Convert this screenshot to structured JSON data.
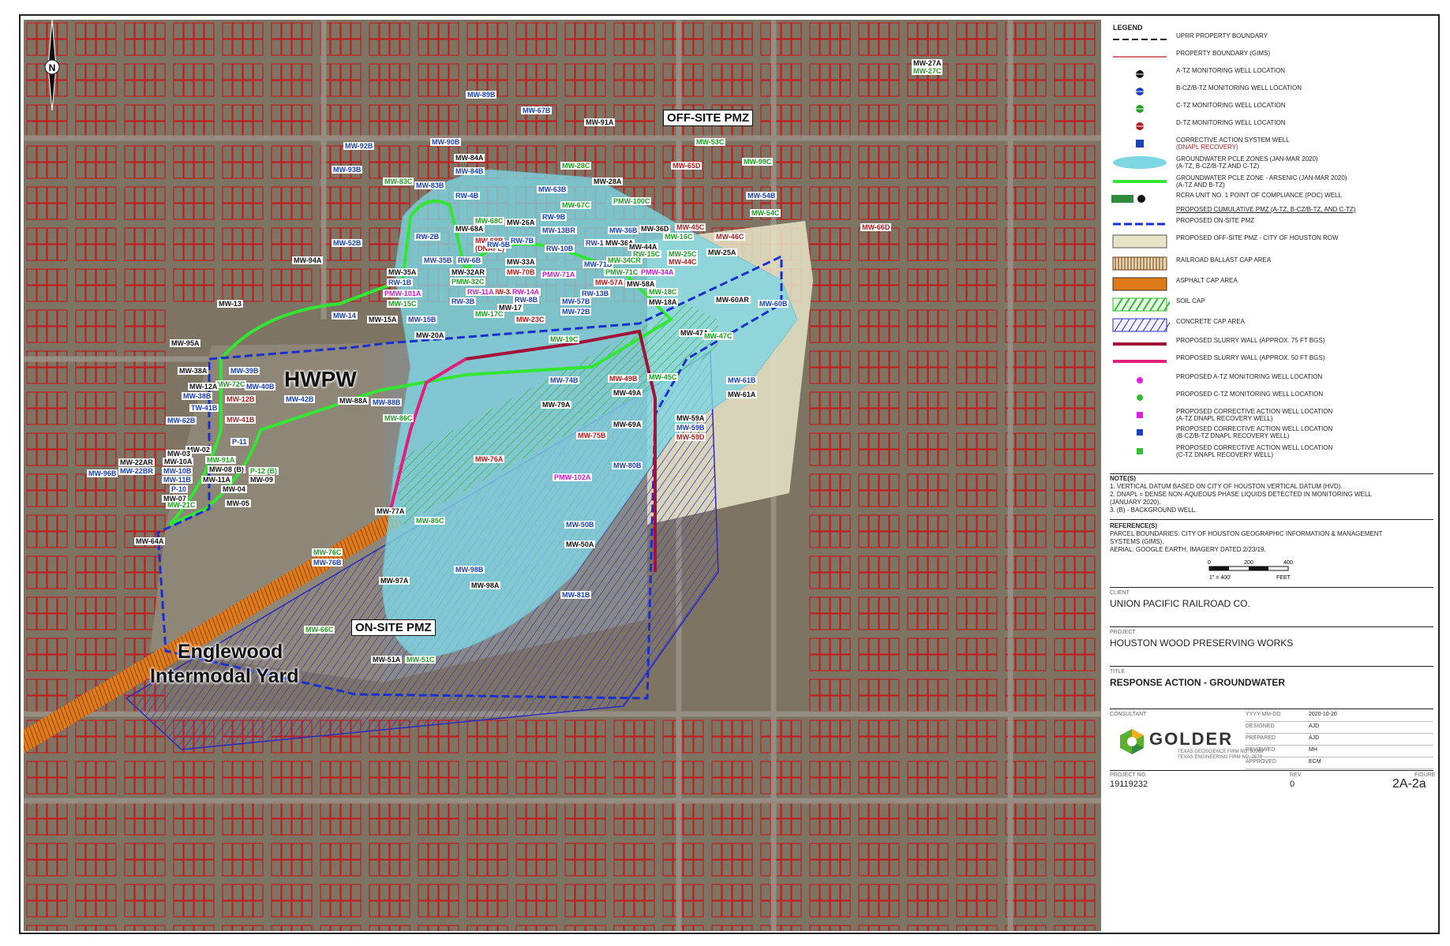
{
  "map": {
    "north_label": "N",
    "site_labels": {
      "hwpw": "HWPW",
      "englewood_line1": "Englewood",
      "englewood_line2": "Intermodal Yard"
    },
    "callouts": {
      "offsite": "OFF-SITE PMZ",
      "onsite": "ON-SITE PMZ"
    },
    "wells": [
      {
        "t": "MW-89B",
        "c": "b"
      },
      {
        "t": "MW-67B",
        "c": "b"
      },
      {
        "t": "MW-91A",
        "c": "k"
      },
      {
        "t": "MW-92B",
        "c": "b"
      },
      {
        "t": "MW-90B",
        "c": "b"
      },
      {
        "t": "MW-84A",
        "c": "k"
      },
      {
        "t": "MW-84B",
        "c": "b"
      },
      {
        "t": "MW-93B",
        "c": "b"
      },
      {
        "t": "MW-83C",
        "c": "g"
      },
      {
        "t": "MW-83B",
        "c": "b"
      },
      {
        "t": "RW-4B",
        "c": "b"
      },
      {
        "t": "MW-28C",
        "c": "g"
      },
      {
        "t": "MW-28A",
        "c": "k"
      },
      {
        "t": "MW-63B",
        "c": "b"
      },
      {
        "t": "MW-53C",
        "c": "g"
      },
      {
        "t": "MW-65D",
        "c": "r"
      },
      {
        "t": "MW-99C",
        "c": "g"
      },
      {
        "t": "MW-54B",
        "c": "b"
      },
      {
        "t": "MW-54C",
        "c": "g"
      },
      {
        "t": "MW-66D",
        "c": "r"
      },
      {
        "t": "MW-27A",
        "c": "k"
      },
      {
        "t": "MW-27C",
        "c": "g"
      },
      {
        "t": "MW-67C",
        "c": "g"
      },
      {
        "t": "PMW-100C",
        "c": "g"
      },
      {
        "t": "RW-9B",
        "c": "b"
      },
      {
        "t": "MW-26A",
        "c": "k"
      },
      {
        "t": "MW-68C",
        "c": "g"
      },
      {
        "t": "MW-68A",
        "c": "k"
      },
      {
        "t": "MW-68B",
        "c": "r"
      },
      {
        "t": "(DNAPL)",
        "c": "r"
      },
      {
        "t": "RW-2B",
        "c": "b"
      },
      {
        "t": "RW-5B",
        "c": "b"
      },
      {
        "t": "RW-7B",
        "c": "b"
      },
      {
        "t": "MW-13BR",
        "c": "b"
      },
      {
        "t": "MW-36D",
        "c": "k"
      },
      {
        "t": "MW-45C",
        "c": "r"
      },
      {
        "t": "MW-46C",
        "c": "r"
      },
      {
        "t": "MW-16C",
        "c": "g"
      },
      {
        "t": "RW-12B",
        "c": "b"
      },
      {
        "t": "MW-36A",
        "c": "k"
      },
      {
        "t": "MW-44A",
        "c": "k"
      },
      {
        "t": "MW-36B",
        "c": "b"
      },
      {
        "t": "RW-10B",
        "c": "b"
      },
      {
        "t": "RW-15C",
        "c": "g"
      },
      {
        "t": "MW-25C",
        "c": "g"
      },
      {
        "t": "MW-44C",
        "c": "r"
      },
      {
        "t": "MW-25A",
        "c": "k"
      },
      {
        "t": "MW-52B",
        "c": "b"
      },
      {
        "t": "MW-94A",
        "c": "k"
      },
      {
        "t": "MW-35B",
        "c": "b"
      },
      {
        "t": "MW-35A",
        "c": "k"
      },
      {
        "t": "RW-6B",
        "c": "b"
      },
      {
        "t": "MW-33A",
        "c": "k"
      },
      {
        "t": "MW-71B",
        "c": "b"
      },
      {
        "t": "MW-34CR",
        "c": "g"
      },
      {
        "t": "PMW-34A",
        "c": "m"
      },
      {
        "t": "RW-1B",
        "c": "b"
      },
      {
        "t": "MW-32AR",
        "c": "k"
      },
      {
        "t": "MW-70B",
        "c": "r"
      },
      {
        "t": "PMW-71A",
        "c": "m"
      },
      {
        "t": "PMW-71C",
        "c": "g"
      },
      {
        "t": "PMW-32C",
        "c": "g"
      },
      {
        "t": "MW-32B",
        "c": "r"
      },
      {
        "t": "MW-57A",
        "c": "r"
      },
      {
        "t": "MW-58A",
        "c": "k"
      },
      {
        "t": "PMW-101A",
        "c": "m"
      },
      {
        "t": "MW-15C",
        "c": "g"
      },
      {
        "t": "RW-11A",
        "c": "m"
      },
      {
        "t": "RW-14A",
        "c": "m"
      },
      {
        "t": "RW-13B",
        "c": "b"
      },
      {
        "t": "MW-18C",
        "c": "g"
      },
      {
        "t": "RW-3B",
        "c": "b"
      },
      {
        "t": "RW-8B",
        "c": "b"
      },
      {
        "t": "MW-57B",
        "c": "b"
      },
      {
        "t": "MW-18A",
        "c": "k"
      },
      {
        "t": "MW-13",
        "c": "k"
      },
      {
        "t": "MW-17",
        "c": "k"
      },
      {
        "t": "MW-17C",
        "c": "g"
      },
      {
        "t": "MW-72B",
        "c": "b"
      },
      {
        "t": "MW-14",
        "c": "b"
      },
      {
        "t": "MW-15A",
        "c": "k"
      },
      {
        "t": "MW-15B",
        "c": "b"
      },
      {
        "t": "MW-23C",
        "c": "r"
      },
      {
        "t": "MW-60AR",
        "c": "k"
      },
      {
        "t": "MW-60B",
        "c": "b"
      },
      {
        "t": "MW-20A",
        "c": "k"
      },
      {
        "t": "MW-47A",
        "c": "k"
      },
      {
        "t": "MW-47C",
        "c": "g"
      },
      {
        "t": "MW-19C",
        "c": "g"
      },
      {
        "t": "MW-95A",
        "c": "k"
      },
      {
        "t": "MW-38A",
        "c": "k"
      },
      {
        "t": "MW-39B",
        "c": "b"
      },
      {
        "t": "MW-72C",
        "c": "g"
      },
      {
        "t": "MW-12A",
        "c": "k"
      },
      {
        "t": "MW-40B",
        "c": "b"
      },
      {
        "t": "MW-38B",
        "c": "b"
      },
      {
        "t": "MW-12B",
        "c": "r"
      },
      {
        "t": "MW-42B",
        "c": "b"
      },
      {
        "t": "MW-88A",
        "c": "k"
      },
      {
        "t": "MW-88B",
        "c": "b"
      },
      {
        "t": "MW-74B",
        "c": "b"
      },
      {
        "t": "MW-49B",
        "c": "r"
      },
      {
        "t": "MW-45C",
        "c": "g"
      },
      {
        "t": "MW-61B",
        "c": "b"
      },
      {
        "t": "MW-49A",
        "c": "k"
      },
      {
        "t": "MW-61A",
        "c": "k"
      },
      {
        "t": "TW-41B",
        "c": "b"
      },
      {
        "t": "MW-41B",
        "c": "r"
      },
      {
        "t": "MW-62B",
        "c": "b"
      },
      {
        "t": "MW-79A",
        "c": "k"
      },
      {
        "t": "MW-86C",
        "c": "g"
      },
      {
        "t": "MW-69A",
        "c": "k"
      },
      {
        "t": "MW-59A",
        "c": "k"
      },
      {
        "t": "MW-59B",
        "c": "b"
      },
      {
        "t": "MW-59D",
        "c": "r"
      },
      {
        "t": "P-11",
        "c": "b"
      },
      {
        "t": "MW-02",
        "c": "k"
      },
      {
        "t": "MW-91A",
        "c": "g"
      },
      {
        "t": "MW-03",
        "c": "k"
      },
      {
        "t": "MW-75B",
        "c": "r"
      },
      {
        "t": "MW-22AR",
        "c": "k"
      },
      {
        "t": "MW-10A",
        "c": "k"
      },
      {
        "t": "MW-08 (B)",
        "c": "k"
      },
      {
        "t": "P-12 (B)",
        "c": "g"
      },
      {
        "t": "MW-22BR",
        "c": "b"
      },
      {
        "t": "MW-96B",
        "c": "b"
      },
      {
        "t": "MW-10B",
        "c": "b"
      },
      {
        "t": "MW-09",
        "c": "k"
      },
      {
        "t": "MW-11B",
        "c": "b"
      },
      {
        "t": "MW-11A",
        "c": "k"
      },
      {
        "t": "MW-76A",
        "c": "r"
      },
      {
        "t": "MW-80B",
        "c": "b"
      },
      {
        "t": "P-10",
        "c": "b"
      },
      {
        "t": "MW-04",
        "c": "k"
      },
      {
        "t": "MW-07",
        "c": "k"
      },
      {
        "t": "PMW-102A",
        "c": "m"
      },
      {
        "t": "MW-21C",
        "c": "g"
      },
      {
        "t": "MW-05",
        "c": "k"
      },
      {
        "t": "MW-77A",
        "c": "k"
      },
      {
        "t": "MW-85C",
        "c": "g"
      },
      {
        "t": "MW-64A",
        "c": "k"
      },
      {
        "t": "MW-50B",
        "c": "b"
      },
      {
        "t": "MW-50A",
        "c": "k"
      },
      {
        "t": "MW-76C",
        "c": "g"
      },
      {
        "t": "MW-76B",
        "c": "b"
      },
      {
        "t": "MW-98B",
        "c": "b"
      },
      {
        "t": "MW-97A",
        "c": "k"
      },
      {
        "t": "MW-98A",
        "c": "k"
      },
      {
        "t": "MW-81B",
        "c": "b"
      },
      {
        "t": "MW-66C",
        "c": "g"
      },
      {
        "t": "MW-51A",
        "c": "k"
      },
      {
        "t": "MW-51C",
        "c": "g"
      }
    ]
  },
  "legend": {
    "title": "LEGEND",
    "items": [
      {
        "sym": "dash-black",
        "text": "UPRR PROPERTY BOUNDARY",
        "sub": ""
      },
      {
        "sym": "line-red",
        "text": "PROPERTY BOUNDARY (GIMS)",
        "sub": ""
      },
      {
        "sym": "well-black",
        "text": "A-TZ MONITORING WELL LOCATION",
        "sub": ""
      },
      {
        "sym": "well-blue",
        "text": "B-CZ/B-TZ MONITORING WELL LOCATION",
        "sub": ""
      },
      {
        "sym": "well-green",
        "text": "C-TZ MONITORING WELL LOCATION",
        "sub": ""
      },
      {
        "sym": "well-red",
        "text": "D-TZ MONITORING WELL LOCATION",
        "sub": ""
      },
      {
        "sym": "cas-well",
        "text": "CORRECTIVE ACTION SYSTEM WELL",
        "sub": "(DNAPL RECOVERY)"
      },
      {
        "sym": "plume-cyan",
        "text": "GROUNDWATER PCLE ZONES (JAN-MAR 2020)",
        "sub": "(A-TZ, B-CZ/B-TZ AND C-TZ)"
      },
      {
        "sym": "plume-green",
        "text": "GROUNDWATER PCLE ZONE - ARSENIC (JAN-MAR 2020)",
        "sub": "(A-TZ AND B-TZ)"
      },
      {
        "sym": "poc-well",
        "text": "RCRA UNIT NO. 1 POINT OF COMPLIANCE (POC) WELL",
        "sub": ""
      },
      {
        "sym": "none",
        "text": "PROPOSED CUMULATIVE PMZ (A-TZ, B-CZ/B-TZ, AND C-TZ)",
        "sub": ""
      },
      {
        "sym": "dash-blue",
        "text": "PROPOSED ON-SITE PMZ",
        "sub": ""
      },
      {
        "sym": "box-beige",
        "text": "PROPOSED OFF-SITE PMZ - CITY OF HOUSTON ROW",
        "sub": ""
      },
      {
        "sym": "box-ballast",
        "text": "RAILROAD BALLAST CAP AREA",
        "sub": ""
      },
      {
        "sym": "box-asphalt",
        "text": "ASPHALT CAP AREA",
        "sub": ""
      },
      {
        "sym": "box-soil",
        "text": "SOIL CAP",
        "sub": ""
      },
      {
        "sym": "box-concrete",
        "text": "CONCRETE CAP AREA",
        "sub": ""
      },
      {
        "sym": "line-darkred",
        "text": "PROPOSED SLURRY WALL (APPROX. 75 FT BGS)",
        "sub": ""
      },
      {
        "sym": "line-pink",
        "text": "PROPOSED SLURRY WALL (APPROX. 50 FT BGS)",
        "sub": ""
      },
      {
        "sym": "dot-magenta",
        "text": "PROPOSED A-TZ MONITORING WELL LOCATION",
        "sub": ""
      },
      {
        "sym": "dot-green",
        "text": "PROPOSED C-TZ MONITORING WELL LOCATION",
        "sub": ""
      },
      {
        "sym": "sq-magenta",
        "text": "PROPOSED CORRECTIVE ACTION WELL LOCATION",
        "sub": "(A-TZ DNAPL RECOVERY WELL)"
      },
      {
        "sym": "sq-blue",
        "text": "PROPOSED CORRECTIVE ACTION WELL LOCATION",
        "sub": "(B-CZ/B-TZ DNAPL RECOVERY WELL)"
      },
      {
        "sym": "sq-green",
        "text": "PROPOSED CORRECTIVE ACTION WELL LOCATION",
        "sub": "(C-TZ DNAPL RECOVERY WELL)"
      }
    ],
    "poc_sample_label": "MW-12A"
  },
  "notes": {
    "title": "NOTE(S)",
    "items": [
      "1.   VERTICAL DATUM BASED ON CITY OF HOUSTON VERTICAL DATUM (HVD).",
      "2.   DNAPL = DENSE NON-AQUEOUS PHASE LIQUIDS DETECTED IN MONITORING WELL",
      "       (JANUARY 2020).",
      "3.   (B) - BACKGROUND WELL."
    ]
  },
  "references": {
    "title": "REFERENCE(S)",
    "lines": [
      "PARCEL BOUNDARIES: CITY OF HOUSTON GEOGRAPHIC INFORMATION & MANAGEMENT",
      "SYSTEMS (GIMS).",
      "AERIAL: GOOGLE EARTH, IMAGERY DATED 2/23/19."
    ],
    "scale_ticks": [
      "0",
      "200",
      "400"
    ],
    "scale_ratio": "1\" = 400'",
    "scale_unit": "FEET"
  },
  "titleblock": {
    "client_cap": "CLIENT",
    "client": "UNION PACIFIC RAILROAD CO.",
    "project_cap": "PROJECT",
    "project": "HOUSTON WOOD PRESERVING WORKS",
    "title_cap": "TITLE",
    "title": "RESPONSE ACTION - GROUNDWATER",
    "consultant_cap": "CONSULTANT",
    "logo_text": "GOLDER",
    "firm_line1": "TEXAS GEOSCIENCE FIRM NO. 50369",
    "firm_line2": "TEXAS ENGINEERING FIRM NO. 2578",
    "rows": [
      {
        "k": "YYYY-MM-DD",
        "v": "2020-10-20"
      },
      {
        "k": "DESIGNED",
        "v": "AJD"
      },
      {
        "k": "PREPARED",
        "v": "AJD"
      },
      {
        "k": "REVIEWED",
        "v": "MH"
      },
      {
        "k": "APPROVED",
        "v": "ECM"
      }
    ],
    "project_no_cap": "PROJECT NO.",
    "project_no": "19119232",
    "rev_cap": "REV.",
    "rev": "0",
    "figure_cap": "FIGURE",
    "figure": "2A-2a"
  },
  "colors": {
    "plume": "#7fd6e3",
    "arsenic": "#33e633",
    "onsite_pmz": "#1a2fd0",
    "slurry75": "#a3123a",
    "slurry50": "#e0207a",
    "asphalt": "#e07a1a",
    "parcel": "#c21f1f"
  }
}
